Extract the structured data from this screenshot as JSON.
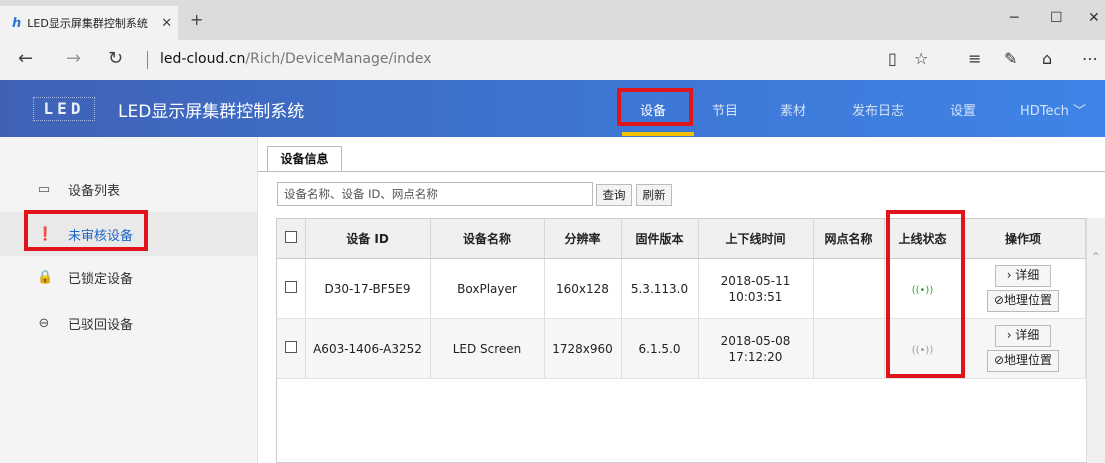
{
  "browser": {
    "tab_title": "LED显示屏集群控制系统",
    "favicon": "hd-logo",
    "url_domain": "led-cloud.cn",
    "url_path": "/Rich/DeviceManage/index"
  },
  "app": {
    "logo_text": "LED",
    "title": "LED显示屏集群控制系统",
    "nav": [
      {
        "label": "设备",
        "active": true
      },
      {
        "label": "节目"
      },
      {
        "label": "素材"
      },
      {
        "label": "发布日志"
      },
      {
        "label": "设置"
      }
    ],
    "user": "HDTech"
  },
  "sidebar": {
    "items": [
      {
        "label": "设备列表",
        "icon": "monitor-icon"
      },
      {
        "label": "未审核设备",
        "icon": "exclamation-circle-icon",
        "active": true
      },
      {
        "label": "已锁定设备",
        "icon": "lock-icon"
      },
      {
        "label": "已驳回设备",
        "icon": "minus-circle-icon"
      }
    ]
  },
  "content": {
    "tab_label": "设备信息",
    "search_placeholder": "设备名称、设备 ID、网点名称",
    "query_button": "查询",
    "refresh_button": "刷新",
    "columns": [
      "设备 ID",
      "设备名称",
      "分辨率",
      "固件版本",
      "上下线时间",
      "网点名称",
      "上线状态",
      "操作项"
    ],
    "rows": [
      {
        "id": "D30-17-BF5E9",
        "name": "BoxPlayer",
        "resolution": "160x128",
        "firmware": "5.3.113.0",
        "date": "2018-05-11",
        "time": "10:03:51",
        "site": "",
        "status": "online",
        "status_color": "#2aa82a",
        "detail": "› 详细",
        "geo": "⊘地理位置"
      },
      {
        "id": "A603-1406-A3252",
        "name": "LED Screen",
        "resolution": "1728x960",
        "firmware": "6.1.5.0",
        "date": "2018-05-08",
        "time": "17:12:20",
        "site": "",
        "status": "offline",
        "status_color": "#999999",
        "detail": "› 详细",
        "geo": "⊘地理位置"
      }
    ]
  },
  "colors": {
    "highlight": "#e0151c",
    "accent": "#3e76d4",
    "nav_underline": "#f5c100"
  }
}
